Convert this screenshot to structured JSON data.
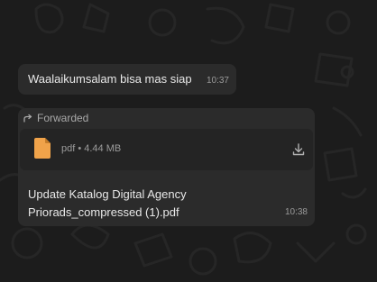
{
  "messages": [
    {
      "text": "Waalaikumsalam bisa mas siap",
      "time": "10:37"
    },
    {
      "forwarded_label": "Forwarded",
      "file_meta": "pdf • 4.44 MB",
      "file_name_lines": [
        "Update Katalog Digital Agency",
        "Priorads_compressed (1).pdf"
      ],
      "time": "10:38"
    }
  ],
  "icons": {
    "forward": "forward-arrow-icon",
    "file": "pdf-file-icon",
    "download": "download-icon"
  },
  "colors": {
    "background": "#1c1c1c",
    "bubble": "#2b2b2b",
    "file_card": "#242424",
    "text": "#e9e9e9",
    "muted": "#9a9a9a",
    "file_icon": "#f0a34a"
  }
}
